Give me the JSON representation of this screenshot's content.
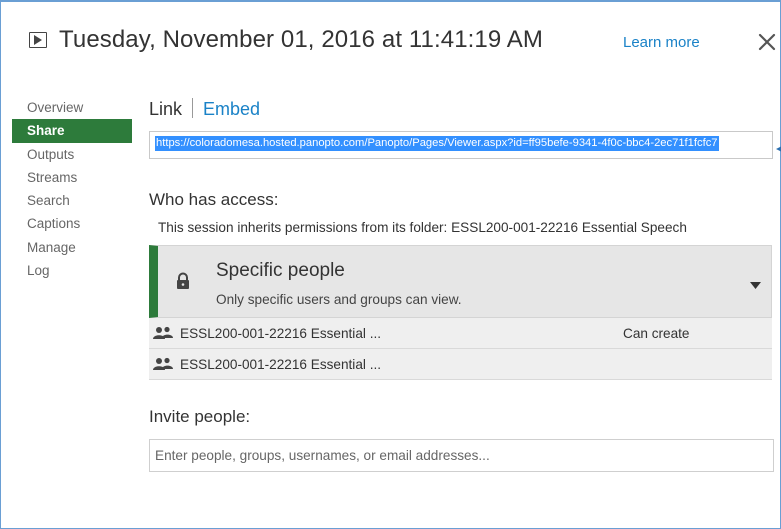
{
  "header": {
    "title": "Tuesday, November 01, 2016 at 11:41:19 AM",
    "learn_more": "Learn more",
    "play_icon": "play-square-icon",
    "close_icon": "close-icon"
  },
  "sidebar": {
    "items": [
      {
        "label": "Overview",
        "active": false
      },
      {
        "label": "Share",
        "active": true
      },
      {
        "label": "Outputs",
        "active": false
      },
      {
        "label": "Streams",
        "active": false
      },
      {
        "label": "Search",
        "active": false
      },
      {
        "label": "Captions",
        "active": false
      },
      {
        "label": "Manage",
        "active": false
      },
      {
        "label": "Log",
        "active": false
      }
    ]
  },
  "share": {
    "tabs": {
      "link": "Link",
      "embed": "Embed"
    },
    "url": "https://coloradomesa.hosted.panopto.com/Panopto/Pages/Viewer.aspx?id=ff95befe-9341-4f0c-bbc4-2ec71f1fcfc7",
    "who_has_access": "Who has access:",
    "inherit_text": "This session inherits permissions from its folder: ESSL200-001-22216 Essential Speech",
    "permission": {
      "title": "Specific people",
      "description": "Only specific users and groups can view.",
      "lock_icon": "lock-icon",
      "dropdown_icon": "dropdown-triangle-icon"
    },
    "access_rows": [
      {
        "name": "ESSL200-001-22216 Essential ...",
        "permission": "Can create"
      },
      {
        "name": "ESSL200-001-22216 Essential ...",
        "permission": ""
      }
    ],
    "invite_title": "Invite people:",
    "invite_placeholder": "Enter people, groups, usernames, or email addresses..."
  },
  "colors": {
    "accent_green": "#2d7b3b",
    "link_blue": "#1a82c7",
    "frame_blue": "#6a9fd4",
    "selection_blue": "#3390ff"
  }
}
